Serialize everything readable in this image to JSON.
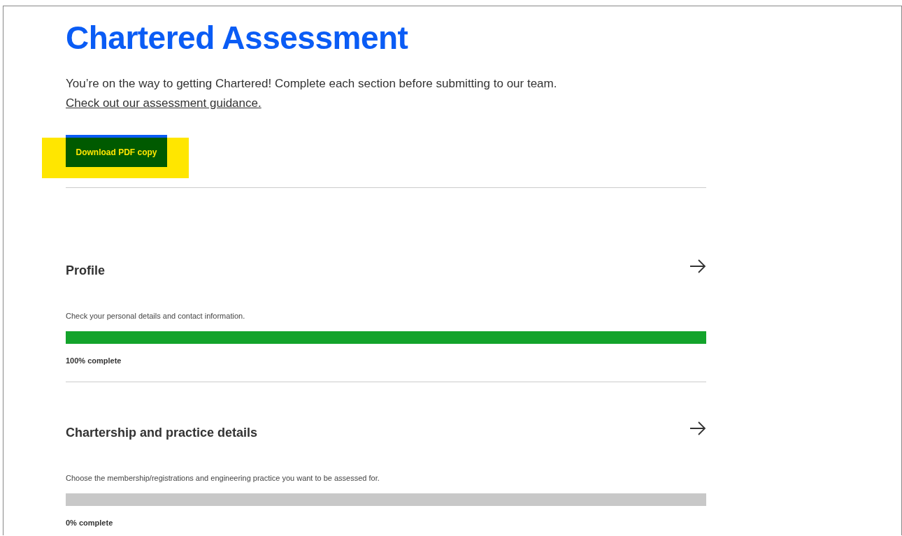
{
  "title": "Chartered Assessment",
  "intro": "You’re on the way to getting Chartered! Complete each section before submitting to our team.",
  "guidance_link": "Check out our assessment guidance.",
  "download_button": {
    "label": "Download PDF copy",
    "highlighted": true
  },
  "sections": [
    {
      "title": "Profile",
      "description": "Check your personal details and contact information.",
      "level": 1,
      "progress_label": "100% complete"
    },
    {
      "title": "Chartership and practice details",
      "description": "Choose the membership/registrations and engineering practice you want to be assessed for.",
      "level": 0,
      "progress_label": "0% complete"
    }
  ]
}
